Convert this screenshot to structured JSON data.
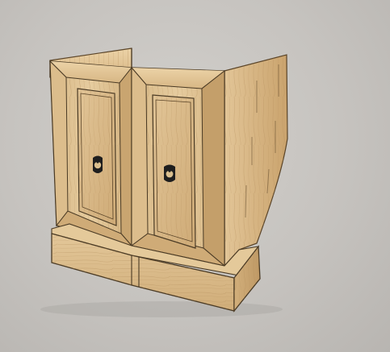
{
  "scene": {
    "subject": "cabinet-render",
    "colors": {
      "background": "#c8c5c1",
      "wood_light": "#e4c99a",
      "wood_mid": "#d2b07a",
      "wood_dark": "#b28e5a",
      "edge_line": "#4a3a24",
      "handle": "#222222"
    },
    "icons": [
      "ring-pull-icon",
      "ring-pull-icon"
    ]
  }
}
